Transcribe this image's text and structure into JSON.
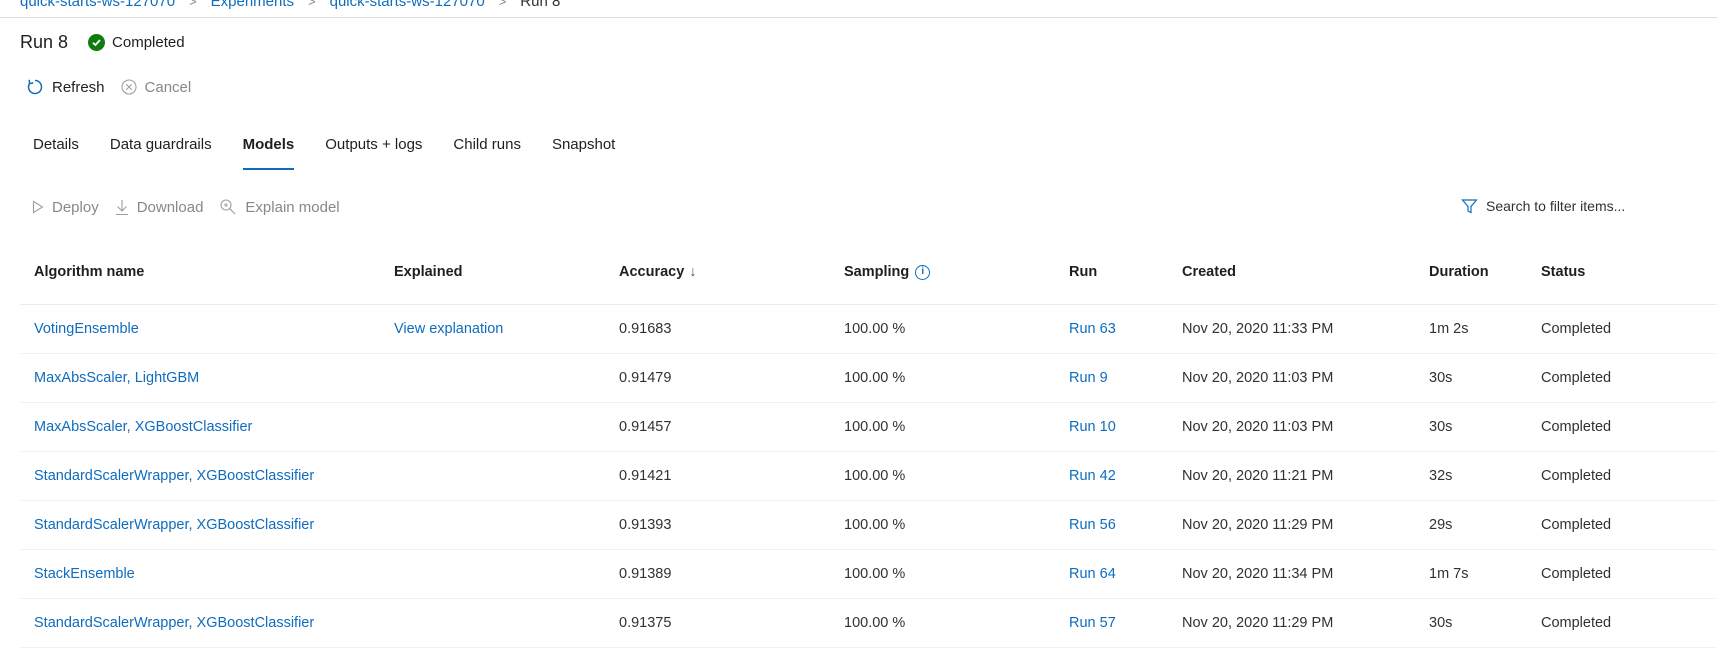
{
  "breadcrumb": {
    "items": [
      "quick-starts-ws-127070",
      "Experiments",
      "quick-starts-ws-127070",
      "Run 8"
    ]
  },
  "header": {
    "title": "Run 8",
    "status": "Completed",
    "status_color": "#107c10"
  },
  "commands": {
    "refresh": "Refresh",
    "cancel": "Cancel"
  },
  "tabs": [
    {
      "label": "Details"
    },
    {
      "label": "Data guardrails"
    },
    {
      "label": "Models",
      "active": true
    },
    {
      "label": "Outputs + logs"
    },
    {
      "label": "Child runs"
    },
    {
      "label": "Snapshot"
    }
  ],
  "model_toolbar": {
    "deploy": "Deploy",
    "download": "Download",
    "explain": "Explain model",
    "search_placeholder": "Search to filter items..."
  },
  "table": {
    "columns": {
      "algorithm": "Algorithm name",
      "explained": "Explained",
      "accuracy": "Accuracy",
      "sampling": "Sampling",
      "run": "Run",
      "created": "Created",
      "duration": "Duration",
      "status": "Status"
    },
    "rows": [
      {
        "algorithm": "VotingEnsemble",
        "explained": "View explanation",
        "accuracy": "0.91683",
        "sampling": "100.00 %",
        "run": "Run 63",
        "created": "Nov 20, 2020 11:33 PM",
        "duration": "1m 2s",
        "status": "Completed"
      },
      {
        "algorithm": "MaxAbsScaler, LightGBM",
        "explained": "",
        "accuracy": "0.91479",
        "sampling": "100.00 %",
        "run": "Run 9",
        "created": "Nov 20, 2020 11:03 PM",
        "duration": "30s",
        "status": "Completed"
      },
      {
        "algorithm": "MaxAbsScaler, XGBoostClassifier",
        "explained": "",
        "accuracy": "0.91457",
        "sampling": "100.00 %",
        "run": "Run 10",
        "created": "Nov 20, 2020 11:03 PM",
        "duration": "30s",
        "status": "Completed"
      },
      {
        "algorithm": "StandardScalerWrapper, XGBoostClassifier",
        "explained": "",
        "accuracy": "0.91421",
        "sampling": "100.00 %",
        "run": "Run 42",
        "created": "Nov 20, 2020 11:21 PM",
        "duration": "32s",
        "status": "Completed"
      },
      {
        "algorithm": "StandardScalerWrapper, XGBoostClassifier",
        "explained": "",
        "accuracy": "0.91393",
        "sampling": "100.00 %",
        "run": "Run 56",
        "created": "Nov 20, 2020 11:29 PM",
        "duration": "29s",
        "status": "Completed"
      },
      {
        "algorithm": "StackEnsemble",
        "explained": "",
        "accuracy": "0.91389",
        "sampling": "100.00 %",
        "run": "Run 64",
        "created": "Nov 20, 2020 11:34 PM",
        "duration": "1m 7s",
        "status": "Completed"
      },
      {
        "algorithm": "StandardScalerWrapper, XGBoostClassifier",
        "explained": "",
        "accuracy": "0.91375",
        "sampling": "100.00 %",
        "run": "Run 57",
        "created": "Nov 20, 2020 11:29 PM",
        "duration": "30s",
        "status": "Completed"
      }
    ]
  }
}
